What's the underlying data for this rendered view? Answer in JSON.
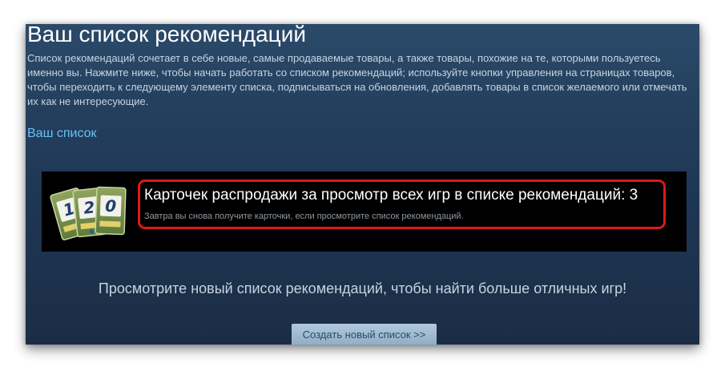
{
  "page": {
    "title": "Ваш список рекомендаций",
    "description": "Список рекомендаций сочетает в себе новые, самые продаваемые товары, а также товары, похожие на те, которыми пользуетесь именно вы. Нажмите ниже, чтобы начать работать со списком рекомендаций; используйте кнопки управления на страницах товаров, чтобы переходить к следующему элементу списка, подписываться на обновления, добавлять товары в список желаемого или отмечать их как не интересующие.",
    "your_list_link": "Ваш список"
  },
  "cards_panel": {
    "heading": "Карточек распродажи за просмотр всех игр в списке рекомендаций: 3",
    "subtext": "Завтра вы снова получите карточки, если просмотрите список рекомендаций.",
    "card_glyphs": [
      "1",
      "2",
      "0"
    ],
    "highlight_color": "#e01818",
    "icon": "trading-cards-icon"
  },
  "prompt_text": "Просмотрите новый список рекомендаций, чтобы найти больше отличных игр!",
  "create_button_label": "Создать новый список >>",
  "colors": {
    "link": "#66c0f4",
    "text": "#c6d4df",
    "panel": "#000000",
    "background_top": "#2b4a6a",
    "background_bottom": "#1b2d46"
  }
}
